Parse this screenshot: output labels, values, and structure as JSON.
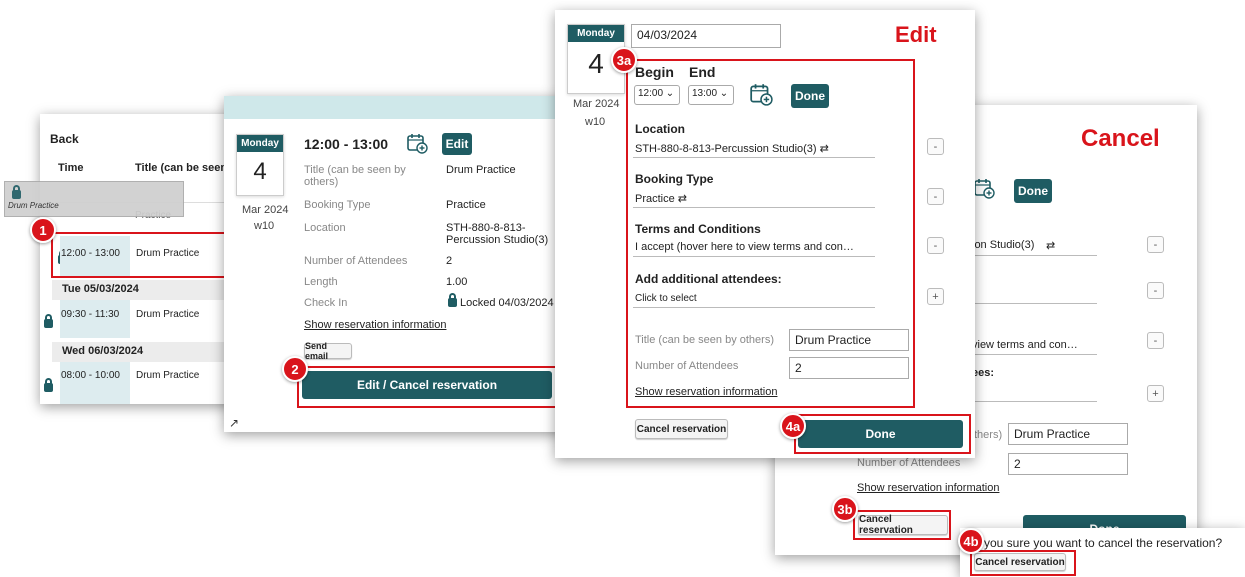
{
  "list_panel": {
    "back": "Back",
    "col_time": "Time",
    "col_title": "Title (can be seen t",
    "drag_label": "Drum Practice",
    "drag_sub": "Practice",
    "rows": [
      {
        "time": "12:00 - 13:00",
        "title": "Drum Practice"
      },
      {
        "day": "Tue 05/03/2024"
      },
      {
        "time": "09:30 - 11:30",
        "title": "Drum Practice"
      },
      {
        "day": "Wed 06/03/2024"
      },
      {
        "time": "08:00 - 10:00",
        "title": "Drum Practice"
      }
    ],
    "hidden_row": "Practice"
  },
  "detail_panel": {
    "weekday": "Monday",
    "day": "4",
    "month": "Mar 2024",
    "week": "w10",
    "time": "12:00 - 13:00",
    "edit": "Edit",
    "fields": [
      {
        "label": "Title (can be seen by others)",
        "value": "Drum Practice"
      },
      {
        "label": "Booking Type",
        "value": "Practice"
      },
      {
        "label": "Location",
        "value": "STH-880-8-813-Percussion Studio(3)"
      },
      {
        "label": "Number of Attendees",
        "value": "2"
      },
      {
        "label": "Length",
        "value": "1.00"
      },
      {
        "label": "Check In",
        "value": "Locked 04/03/2024"
      }
    ],
    "show_info": "Show reservation information",
    "send_email": "Send email",
    "edit_cancel": "Edit / Cancel reservation"
  },
  "edit_panel": {
    "weekday": "Monday",
    "day": "4",
    "month": "Mar 2024",
    "week": "w10",
    "date": "04/03/2024",
    "heading": "Edit",
    "begin": "Begin",
    "end": "End",
    "begin_val": "12:00",
    "end_val": "13:00",
    "done_small": "Done",
    "location_label": "Location",
    "location_val": "STH-880-8-813-Percussion Studio(3)",
    "booking_label": "Booking Type",
    "booking_val": "Practice",
    "terms_label": "Terms and Conditions",
    "terms_val": "I accept (hover here to view terms and con…",
    "attendees_label": "Add additional attendees:",
    "attendees_val": "Click to select",
    "title_label": "Title (can be seen by others)",
    "title_val": "Drum Practice",
    "num_label": "Number of Attendees",
    "num_val": "2",
    "show_info": "Show reservation information",
    "cancel": "Cancel reservation",
    "done": "Done"
  },
  "cancel_panel": {
    "heading": "Cancel",
    "done_small": "Done",
    "location_tail": "ion Studio(3)",
    "terms_tail": "view terms and con…",
    "attendees_tail": "ees:",
    "title_tail": "thers)",
    "title_val": "Drum Practice",
    "num_label": "Number of Attendees",
    "num_val": "2",
    "show_info": "Show reservation information",
    "cancel": "Cancel reservation",
    "done": "Done",
    "confirm": "you sure you want to cancel the reservation?",
    "confirm_btn": "Cancel reservation"
  },
  "badges": {
    "b1": "1",
    "b2": "2",
    "b3a": "3a",
    "b3b": "3b",
    "b4a": "4a",
    "b4b": "4b"
  },
  "colors": {
    "teal": "#1f5c63",
    "red": "#d9141b",
    "heading_red": "#d9141b"
  }
}
